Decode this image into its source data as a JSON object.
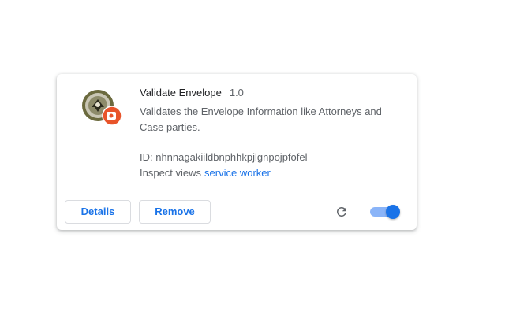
{
  "extension": {
    "name": "Validate Envelope",
    "version": "1.0",
    "description": "Validates the Envelope Information like Attorneys and Case parties.",
    "id_label": "ID: nhnnagakiildbnphhkpjlgnpojpfofel",
    "inspect_label": "Inspect views",
    "inspect_link": "service worker",
    "enabled": true
  },
  "actions": {
    "details_label": "Details",
    "remove_label": "Remove"
  },
  "icons": {
    "extension": "seal-logo-icon",
    "badge": "record-badge-icon",
    "reload": "reload-icon"
  },
  "colors": {
    "accent": "#1a73e8",
    "badge": "#e8542a"
  }
}
